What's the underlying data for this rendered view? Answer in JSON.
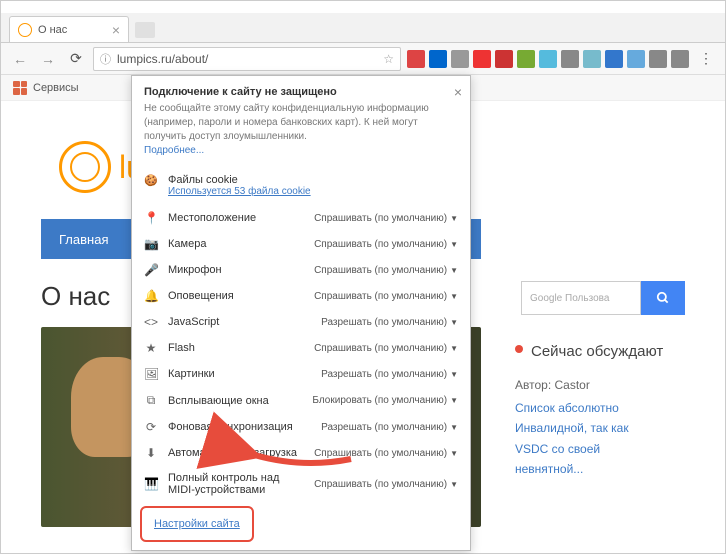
{
  "window": {
    "tab_title": "О нас",
    "url": "lumpics.ru/about/"
  },
  "bookmarks_bar": {
    "services": "Сервисы"
  },
  "toolbar_ext_colors": [
    "#d44",
    "#06c",
    "#999",
    "#e33",
    "#c33",
    "#7a3",
    "#5bd",
    "#888",
    "#7bc",
    "#37c",
    "#6ad",
    "#888",
    "#888"
  ],
  "page": {
    "logo_text": "lu",
    "nav_home": "Главная",
    "heading": "О нас",
    "search_placeholder": "Google Пользова",
    "sidebar": {
      "now_discussing": "Сейчас обсуждают",
      "author_label": "Автор: Castor",
      "link_lines": [
        "Список абсолютно",
        "Инвалидной, так как",
        "VSDC со своей",
        "невнятной..."
      ]
    }
  },
  "popup": {
    "title": "Подключение к сайту не защищено",
    "desc": "Не сообщайте этому сайту конфиденциальную информацию (например, пароли и номера банковских карт). К ней могут получить доступ злоумышленники.",
    "more": "Подробнее...",
    "cookies_title": "Файлы cookie",
    "cookies_link": "Используется 53 файла cookie",
    "permissions": [
      {
        "icon": "📍",
        "label": "Местоположение",
        "value": "Спрашивать (по умолчанию)"
      },
      {
        "icon": "📷",
        "label": "Камера",
        "value": "Спрашивать (по умолчанию)"
      },
      {
        "icon": "🎤",
        "label": "Микрофон",
        "value": "Спрашивать (по умолчанию)"
      },
      {
        "icon": "🔔",
        "label": "Оповещения",
        "value": "Спрашивать (по умолчанию)"
      },
      {
        "icon": "<>",
        "label": "JavaScript",
        "value": "Разрешать (по умолчанию)"
      },
      {
        "icon": "★",
        "label": "Flash",
        "value": "Спрашивать (по умолчанию)"
      },
      {
        "icon": "🖼",
        "label": "Картинки",
        "value": "Разрешать (по умолчанию)"
      },
      {
        "icon": "⧉",
        "label": "Всплывающие окна",
        "value": "Блокировать (по умолчанию)"
      },
      {
        "icon": "⟳",
        "label": "Фоновая синхронизация",
        "value": "Разрешать (по умолчанию)"
      },
      {
        "icon": "⬇",
        "label": "Автоматическая загрузка",
        "value": "Спрашивать (по умолчанию)"
      },
      {
        "icon": "🎹",
        "label": "Полный контроль над MIDI-устройствами",
        "value": "Спрашивать (по умолчанию)"
      }
    ],
    "site_settings": "Настройки сайта"
  }
}
